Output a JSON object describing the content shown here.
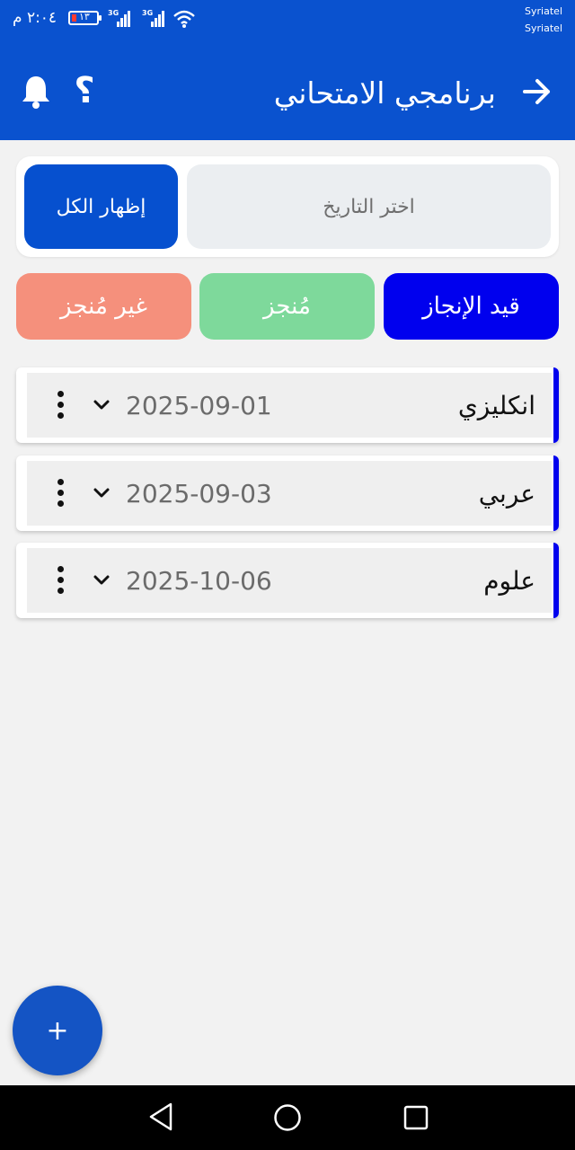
{
  "status_bar": {
    "time": "٢:٠٤ م",
    "battery": "١٣",
    "network_1": "3G",
    "network_2": "3G",
    "carrier_1": "Syriatel",
    "carrier_2": "Syriatel"
  },
  "header": {
    "title": "برنامجي الامتحاني",
    "back_icon": "arrow-right-icon",
    "help_label": "؟",
    "bell_icon": "bell-icon"
  },
  "filter": {
    "date_placeholder": "اختر التاريخ",
    "show_all_label": "إظهار الكل"
  },
  "tabs": [
    {
      "label": "قيد الإنجاز",
      "color": "#0000ee"
    },
    {
      "label": "مُنجز",
      "color": "#7ed99b"
    },
    {
      "label": "غير مُنجز",
      "color": "#f5907c"
    }
  ],
  "exams": [
    {
      "subject": "انكليزي",
      "date": "2025-09-01"
    },
    {
      "subject": "عربي",
      "date": "2025-09-03"
    },
    {
      "subject": "علوم",
      "date": "2025-10-06"
    }
  ],
  "fab": {
    "label": "+"
  },
  "colors": {
    "primary": "#0a52cf",
    "accent_blue": "#0000ee",
    "background": "#f2f2f2"
  }
}
